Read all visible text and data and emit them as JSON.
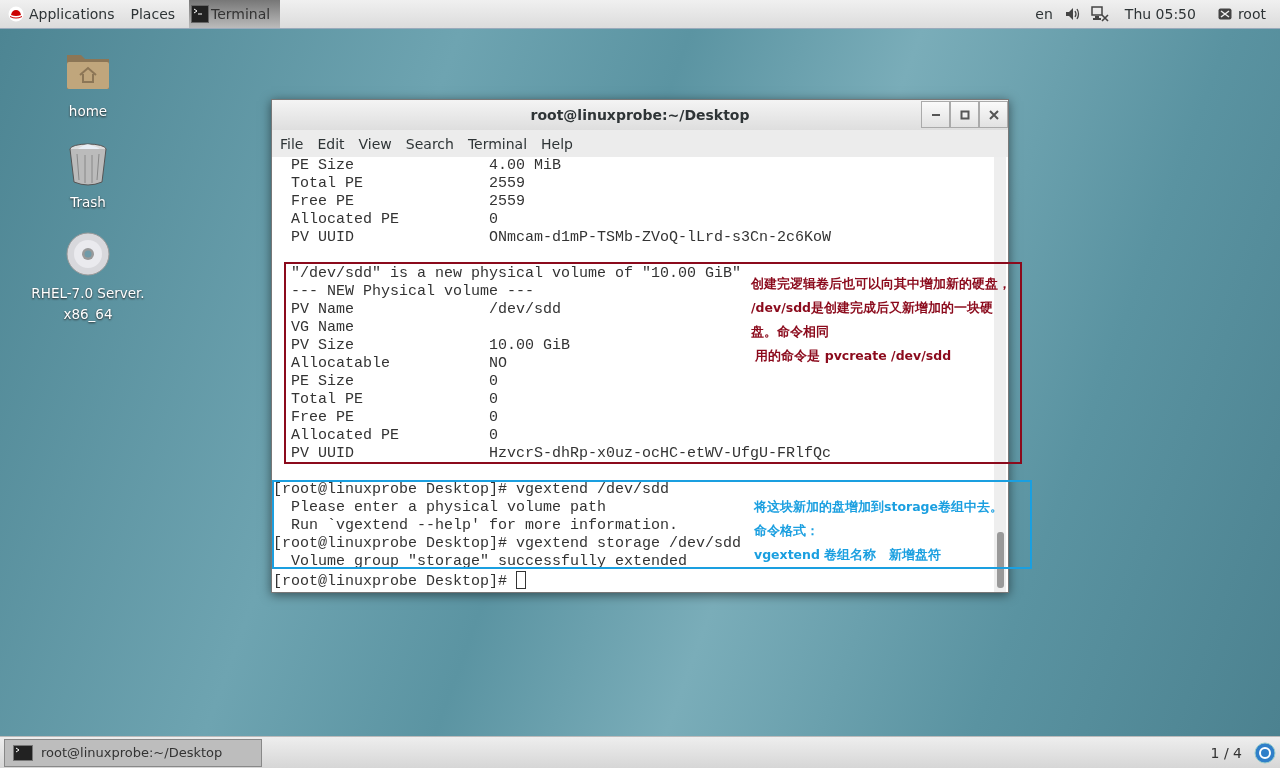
{
  "top_bar": {
    "menus": [
      {
        "label": "Applications"
      },
      {
        "label": "Places"
      }
    ],
    "active_app": {
      "label": "Terminal"
    },
    "language": "en",
    "clock": "Thu 05:50",
    "user": "root"
  },
  "desktop_icons": [
    {
      "kind": "folder",
      "label": "home"
    },
    {
      "kind": "trash",
      "label": "Trash"
    },
    {
      "kind": "disc",
      "label": "RHEL-7.0 Server. x86_64"
    }
  ],
  "terminal": {
    "title": "root@linuxprobe:~/Desktop",
    "menu": [
      "File",
      "Edit",
      "View",
      "Search",
      "Terminal",
      "Help"
    ],
    "blocks": [
      {
        "kind": "plain",
        "lines": [
          "  PE Size               4.00 MiB",
          "  Total PE              2559",
          "  Free PE               2559",
          "  Allocated PE          0",
          "  PV UUID               ONmcam-d1mP-TSMb-ZVoQ-lLrd-s3Cn-2c6KoW"
        ]
      },
      {
        "kind": "blank"
      },
      {
        "kind": "annotated",
        "color": "#8b0a1c",
        "note": [
          "创建完逻辑卷后也可以向其中增加新的硬盘，",
          "/dev/sdd是创建完成后又新增加的一块硬",
          "盘。命令相同",
          " 用的命令是 pvcreate /dev/sdd"
        ],
        "lines": [
          "  \"/dev/sdd\" is a new physical volume of \"10.00 GiB\"",
          "  --- NEW Physical volume ---",
          "  PV Name               /dev/sdd",
          "  VG Name",
          "  PV Size               10.00 GiB",
          "  Allocatable           NO",
          "  PE Size               0",
          "  Total PE              0",
          "  Free PE               0",
          "  Allocated PE          0",
          "  PV UUID               HzvcrS-dhRp-x0uz-ocHC-etWV-UfgU-FRlfQc"
        ]
      },
      {
        "kind": "blank"
      },
      {
        "kind": "annotated",
        "color": "#1a9fe0",
        "note": [
          "将这块新加的盘增加到storage卷组中去。",
          "命令格式：",
          "vgextend 卷组名称   新增盘符"
        ],
        "lines": [
          "[root@linuxprobe Desktop]# vgextend /dev/sdd",
          "  Please enter a physical volume path",
          "  Run `vgextend --help' for more information.",
          "[root@linuxprobe Desktop]# vgextend storage /dev/sdd",
          "  Volume group \"storage\" successfully extended"
        ]
      },
      {
        "kind": "prompt",
        "lines": [
          "[root@linuxprobe Desktop]# "
        ]
      }
    ]
  },
  "taskbar": {
    "windows": [
      {
        "label": "root@linuxprobe:~/Desktop",
        "selected": true
      }
    ],
    "workspace": "1 / 4"
  }
}
